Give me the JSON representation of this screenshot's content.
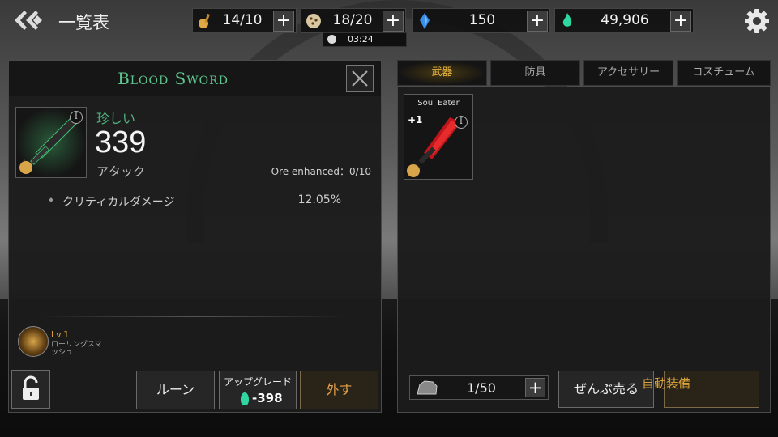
{
  "header": {
    "title": "一覧表",
    "resources": [
      {
        "icon": "lute-icon",
        "value": "14/10"
      },
      {
        "icon": "cookie-icon",
        "value": "18/20",
        "timer": "03:24"
      },
      {
        "icon": "blue-crystal-icon",
        "value": "150"
      },
      {
        "icon": "green-flame-icon",
        "value": "49,906"
      }
    ],
    "plus": "+"
  },
  "item": {
    "name": "Blood Sword",
    "rarity": "珍しい",
    "power": "339",
    "stat_type": "アタック",
    "ore_enhanced": "Ore enhanced：0/10",
    "tier_badge": "I",
    "sub_stats": [
      {
        "name": "クリティカルダメージ",
        "value": "12.05%"
      }
    ],
    "skill": {
      "level": "Lv.1",
      "name": "ローリングスマッシュ"
    },
    "buttons": {
      "rune": "ルーン",
      "upgrade": "アップグレード",
      "upgrade_cost": "-398",
      "unequip": "外す"
    }
  },
  "inventory": {
    "tabs": [
      "武器",
      "防具",
      "アクセサリー",
      "コスチューム"
    ],
    "active_tab": "武器",
    "items": [
      {
        "name": "Soul Eater",
        "level": "+1",
        "tier_badge": "I"
      }
    ],
    "capacity": "1/50",
    "sell_all": "ぜんぶ売る",
    "auto_equip": "自動装備"
  },
  "colors": {
    "accent_green": "#5fc48e",
    "accent_gold": "#e6b23c"
  }
}
